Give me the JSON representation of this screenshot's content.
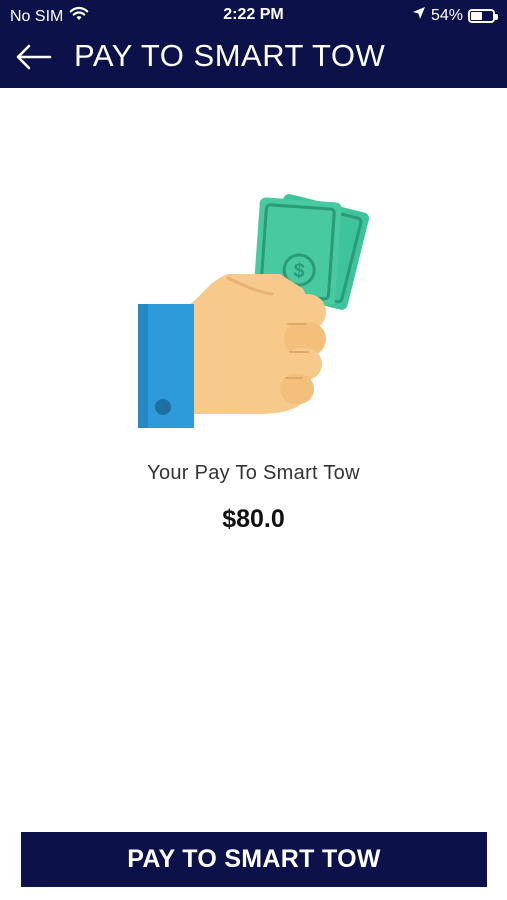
{
  "status_bar": {
    "carrier": "No SIM",
    "time": "2:22 PM",
    "battery_percent": "54%",
    "battery_level": 0.54,
    "icons": [
      "wifi-icon",
      "location-arrow-icon",
      "battery-icon"
    ]
  },
  "header": {
    "back_icon": "arrow-left-icon",
    "title": "PAY TO SMART TOW"
  },
  "illustration": {
    "name": "hand-holding-cash-icon"
  },
  "payment": {
    "caption": "Your Pay To Smart Tow",
    "amount": "$80.0"
  },
  "action": {
    "button_label": "PAY TO SMART TOW"
  },
  "colors": {
    "primary": "#0c1149",
    "background": "#ffffff",
    "cash": "#3ec39a",
    "sleeve": "#2d9bd9",
    "skin": "#f7c98a"
  }
}
